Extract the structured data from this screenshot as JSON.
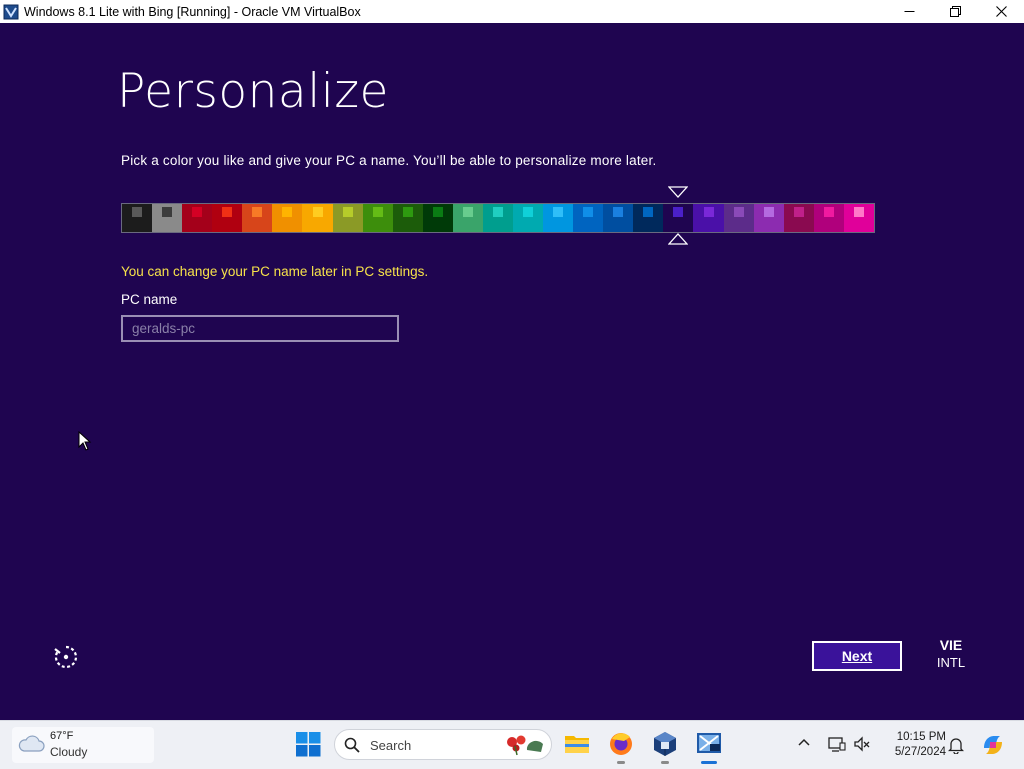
{
  "window": {
    "title": "Windows 8.1 Lite with Bing [Running] - Oracle VM VirtualBox",
    "controls": [
      "minimize-icon",
      "restore-icon",
      "close-icon"
    ]
  },
  "oobe": {
    "title": "Personalize",
    "instruction": "Pick a color you like and give your PC a name. You’ll be able to personalize more later.",
    "note": "You can change your PC name later in PC settings.",
    "pc_name_label": "PC name",
    "pc_name_placeholder": "geralds-pc",
    "pc_name_value": "",
    "next_label": "Next",
    "lang_primary": "VIE",
    "lang_secondary": "INTL",
    "selected_swatch_index": 18,
    "colors": {
      "background": "#1f0550",
      "note_text": "#f7e34a",
      "next_fill": "#3a129a"
    },
    "swatches": [
      {
        "bg": "#1c1c1c",
        "chip": "#595959"
      },
      {
        "bg": "#8a8a8a",
        "chip": "#3c3c3c"
      },
      {
        "bg": "#a4001a",
        "chip": "#d40024"
      },
      {
        "bg": "#b00010",
        "chip": "#f03015"
      },
      {
        "bg": "#d7451a",
        "chip": "#f77a26"
      },
      {
        "bg": "#f09000",
        "chip": "#ffb400"
      },
      {
        "bg": "#f8a800",
        "chip": "#ffcc20"
      },
      {
        "bg": "#8b9a26",
        "chip": "#b6cc2a"
      },
      {
        "bg": "#3d8e0c",
        "chip": "#64bc16"
      },
      {
        "bg": "#1c5c0a",
        "chip": "#2e9a10"
      },
      {
        "bg": "#003a08",
        "chip": "#0a7c14"
      },
      {
        "bg": "#3aa46a",
        "chip": "#68cc8e"
      },
      {
        "bg": "#009e8e",
        "chip": "#20cec0"
      },
      {
        "bg": "#00aab0",
        "chip": "#10d0d8"
      },
      {
        "bg": "#0096e0",
        "chip": "#2fbef8"
      },
      {
        "bg": "#0064c0",
        "chip": "#108ee8"
      },
      {
        "bg": "#004ea0",
        "chip": "#1a80e0"
      },
      {
        "bg": "#00295c",
        "chip": "#0066c0"
      },
      {
        "bg": "#1f0550",
        "chip": "#4a20c8"
      },
      {
        "bg": "#4a10a8",
        "chip": "#7a28d8"
      },
      {
        "bg": "#5c2c8a",
        "chip": "#8a4ab8"
      },
      {
        "bg": "#8c2cb0",
        "chip": "#b46ae0"
      },
      {
        "bg": "#8a0a50",
        "chip": "#c0208a"
      },
      {
        "bg": "#b0007c",
        "chip": "#f01aa0"
      },
      {
        "bg": "#e0009a",
        "chip": "#ff78c8"
      }
    ]
  },
  "taskbar": {
    "weather_temp": "67°F",
    "weather_condition": "Cloudy",
    "search_placeholder": "Search",
    "time": "10:15 PM",
    "date": "5/27/2024",
    "apps": [
      "file-explorer-icon",
      "firefox-icon",
      "virtualbox-icon",
      "windows81-vm-icon"
    ]
  }
}
